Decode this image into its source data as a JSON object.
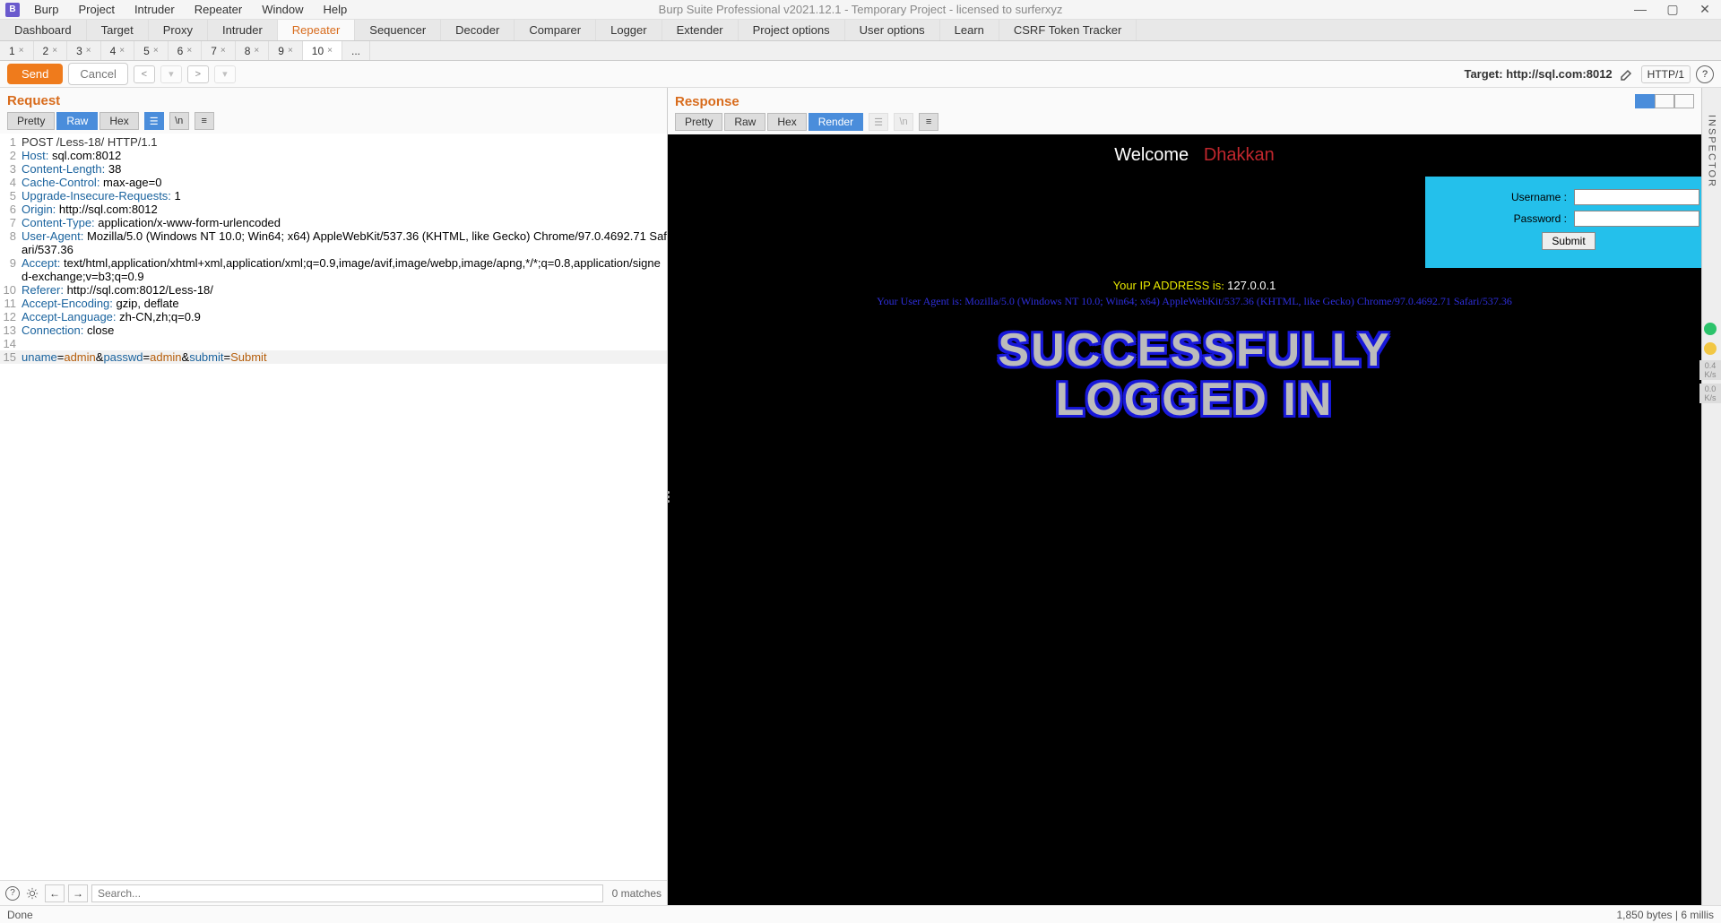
{
  "title": "Burp Suite Professional v2021.12.1 - Temporary Project - licensed to surferxyz",
  "menus": [
    "Burp",
    "Project",
    "Intruder",
    "Repeater",
    "Window",
    "Help"
  ],
  "mainTabs": [
    "Dashboard",
    "Target",
    "Proxy",
    "Intruder",
    "Repeater",
    "Sequencer",
    "Decoder",
    "Comparer",
    "Logger",
    "Extender",
    "Project options",
    "User options",
    "Learn",
    "CSRF Token Tracker"
  ],
  "mainTabActive": "Repeater",
  "subTabs": [
    "1",
    "2",
    "3",
    "4",
    "5",
    "6",
    "7",
    "8",
    "9",
    "10"
  ],
  "subTabActive": "10",
  "subTabMore": "...",
  "action": {
    "send": "Send",
    "cancel": "Cancel",
    "target_prefix": "Target: ",
    "target": "http://sql.com:8012",
    "protocol": "HTTP/1"
  },
  "panes": {
    "request": {
      "title": "Request",
      "viewTabs": [
        "Pretty",
        "Raw",
        "Hex"
      ],
      "activeView": "Raw"
    },
    "response": {
      "title": "Response",
      "viewTabs": [
        "Pretty",
        "Raw",
        "Hex",
        "Render"
      ],
      "activeView": "Render"
    }
  },
  "requestLines": [
    {
      "n": "1",
      "header": "",
      "value": "POST /Less-18/ HTTP/1.1",
      "raw": true
    },
    {
      "n": "2",
      "header": "Host:",
      "value": " sql.com:8012"
    },
    {
      "n": "3",
      "header": "Content-Length:",
      "value": " 38"
    },
    {
      "n": "4",
      "header": "Cache-Control:",
      "value": " max-age=0"
    },
    {
      "n": "5",
      "header": "Upgrade-Insecure-Requests:",
      "value": " 1"
    },
    {
      "n": "6",
      "header": "Origin:",
      "value": " http://sql.com:8012"
    },
    {
      "n": "7",
      "header": "Content-Type:",
      "value": " application/x-www-form-urlencoded"
    },
    {
      "n": "8",
      "header": "User-Agent:",
      "value": " Mozilla/5.0 (Windows NT 10.0; Win64; x64) AppleWebKit/537.36 (KHTML, like Gecko) Chrome/97.0.4692.71 Safari/537.36"
    },
    {
      "n": "9",
      "header": "Accept:",
      "value": " text/html,application/xhtml+xml,application/xml;q=0.9,image/avif,image/webp,image/apng,*/*;q=0.8,application/signed-exchange;v=b3;q=0.9"
    },
    {
      "n": "10",
      "header": "Referer:",
      "value": " http://sql.com:8012/Less-18/"
    },
    {
      "n": "11",
      "header": "Accept-Encoding:",
      "value": " gzip, deflate"
    },
    {
      "n": "12",
      "header": "Accept-Language:",
      "value": " zh-CN,zh;q=0.9"
    },
    {
      "n": "13",
      "header": "Connection:",
      "value": " close"
    },
    {
      "n": "14",
      "header": "",
      "value": ""
    }
  ],
  "requestBody": {
    "n": "15",
    "parts": [
      {
        "k": "uname",
        "v": "admin"
      },
      {
        "k": "passwd",
        "v": "admin"
      },
      {
        "k": "submit",
        "v": "Submit"
      }
    ]
  },
  "render": {
    "welcome": "Welcome",
    "name": "Dhakkan",
    "usernameLabel": "Username :",
    "passwordLabel": "Password :",
    "submit": "Submit",
    "ipLabel": "Your IP ADDRESS is",
    "ipValue": "127.0.0.1",
    "uaLine": "Your User Agent is: Mozilla/5.0 (Windows NT 10.0; Win64; x64) AppleWebKit/537.36 (KHTML, like Gecko) Chrome/97.0.4692.71 Safari/537.36",
    "success1": "SUCCESSFULLY",
    "success2": "LOGGED IN"
  },
  "search": {
    "placeholder": "Search...",
    "matches": "0 matches"
  },
  "status": {
    "left": "Done",
    "right": "1,850 bytes | 6 millis"
  },
  "inspector": "INSPECTOR",
  "badges": {
    "a": "0.4",
    "ak": "K/s",
    "b": "0.0",
    "bk": "K/s"
  }
}
